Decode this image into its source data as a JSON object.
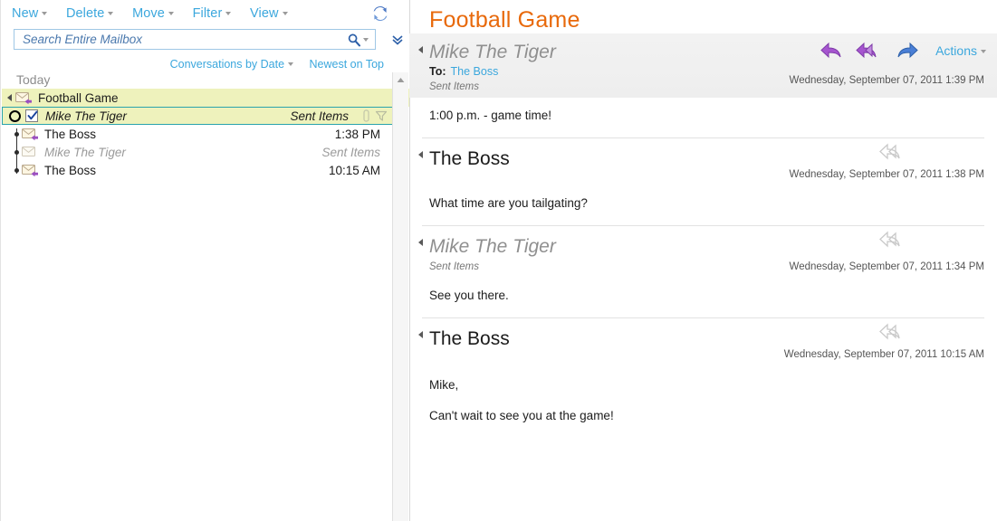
{
  "toolbar": {
    "items": [
      {
        "label": "New",
        "has_caret": true
      },
      {
        "label": "Delete",
        "has_caret": true
      },
      {
        "label": "Move",
        "has_caret": true
      },
      {
        "label": "Filter",
        "has_caret": true
      },
      {
        "label": "View",
        "has_caret": true
      }
    ],
    "refresh_icon": "refresh-icon"
  },
  "search": {
    "placeholder": "Search Entire Mailbox",
    "value": "",
    "search_icon": "magnifier-icon",
    "dropdown_icon": "caret-down-icon",
    "expand_icon": "double-chevron-down-icon"
  },
  "sort": {
    "group_by": "Conversations by Date",
    "order": "Newest on Top"
  },
  "list": {
    "day_header": "Today",
    "conversation": {
      "subject": "Football Game",
      "expanded_icon": "triangle-collapse-icon",
      "envelope_icon": "envelope-reply-icon"
    },
    "rows": [
      {
        "sender": "Mike The Tiger",
        "meta": "Sent Items",
        "selected": true,
        "unread_marker": true,
        "checked": true,
        "italic": true,
        "muted": false,
        "icons": [
          "attachment-icon",
          "flag-icon"
        ]
      },
      {
        "sender": "The Boss",
        "meta": "1:38 PM",
        "selected": false,
        "unread_marker": false,
        "checked": false,
        "italic": false,
        "muted": false,
        "icons": []
      },
      {
        "sender": "Mike The Tiger",
        "meta": "Sent Items",
        "selected": false,
        "unread_marker": false,
        "checked": false,
        "italic": true,
        "muted": true,
        "icons": []
      },
      {
        "sender": "The Boss",
        "meta": "10:15 AM",
        "selected": false,
        "unread_marker": false,
        "checked": false,
        "italic": false,
        "muted": false,
        "icons": []
      }
    ]
  },
  "reading_pane": {
    "subject": "Football Game",
    "actions": {
      "reply_icon": "reply-icon",
      "reply_all_icon": "reply-all-icon",
      "forward_icon": "forward-icon",
      "menu_label": "Actions"
    },
    "messages": [
      {
        "from": "Mike The Tiger",
        "unread_style": true,
        "to_label": "To:",
        "to_value": "The Boss",
        "folder": "Sent Items",
        "timestamp": "Wednesday, September 07, 2011 1:39 PM",
        "body": [
          "1:00 p.m. - game time!"
        ],
        "has_action_bar": true,
        "ghost_reply_icon": null
      },
      {
        "from": "The Boss",
        "unread_style": false,
        "to_label": "",
        "to_value": "",
        "folder": "",
        "timestamp": "Wednesday, September 07, 2011 1:38 PM",
        "body": [
          "What time are you tailgating?"
        ],
        "has_action_bar": false,
        "ghost_reply_icon": "reply-all-ghost-icon"
      },
      {
        "from": "Mike The Tiger",
        "unread_style": true,
        "to_label": "",
        "to_value": "",
        "folder": "Sent Items",
        "timestamp": "Wednesday, September 07, 2011 1:34 PM",
        "body": [
          "See you there."
        ],
        "has_action_bar": false,
        "ghost_reply_icon": "reply-all-ghost-icon"
      },
      {
        "from": "The Boss",
        "unread_style": false,
        "to_label": "",
        "to_value": "",
        "folder": "",
        "timestamp": "Wednesday, September 07, 2011 10:15 AM",
        "body": [
          "Mike,",
          "Can't wait to see you at the game!"
        ],
        "has_action_bar": false,
        "ghost_reply_icon": "reply-all-ghost-icon"
      }
    ]
  },
  "colors": {
    "accent_link": "#3ba7dd",
    "subject_orange": "#e8690b",
    "selection_yellow": "#eef2bc",
    "selection_border": "#2aa3ac",
    "reply_purple": "#9b4fc0",
    "forward_blue": "#2f6fd0"
  }
}
